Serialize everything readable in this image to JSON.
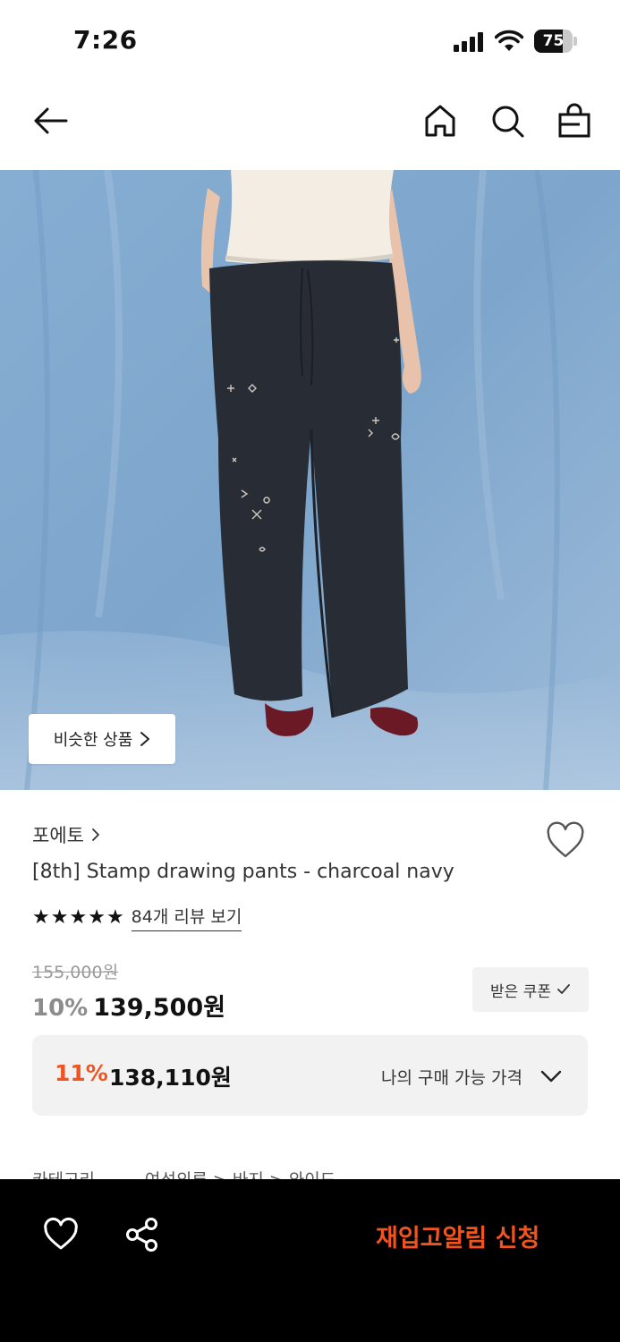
{
  "status_bar": {
    "time": "7:26",
    "battery_level": "75",
    "battery_fraction": 0.75
  },
  "nav": {
    "back_icon": "arrow-left-icon",
    "home_icon": "home-icon",
    "search_icon": "search-icon",
    "bag_icon": "shopping-bag-icon"
  },
  "image": {
    "similar_label": "비슷한 상품"
  },
  "product": {
    "brand": "포에토",
    "name": "[8th] Stamp drawing pants - charcoal navy",
    "rating_stars": 5,
    "review_link": "84개 리뷰 보기",
    "original_price": "155,000원",
    "discount": "10%",
    "price": "139,500원",
    "coupon_label": "받은 쿠폰"
  },
  "my_price": {
    "discount": "11%",
    "price": "138,110원",
    "label": "나의 구매 가능 가격"
  },
  "category": {
    "label": "카테고리",
    "path": "여성의류 > 바지 > 와이드"
  },
  "bottom_bar": {
    "restock_label": "재입고알림 신청"
  },
  "colors": {
    "accent": "#f2541f",
    "background": "#ffffff",
    "bottom_bar": "#000000",
    "price_box": "#f2f2f2"
  }
}
